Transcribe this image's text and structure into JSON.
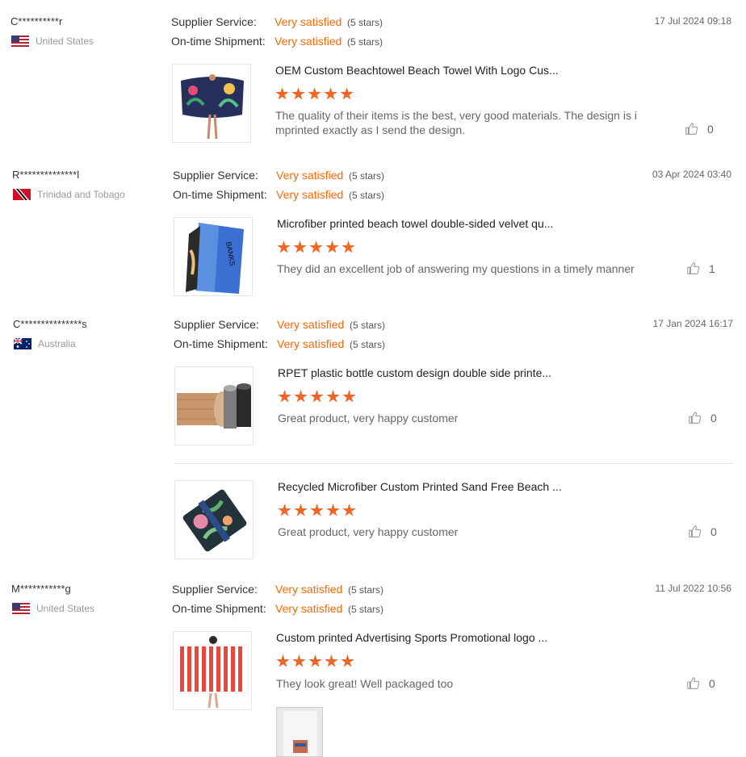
{
  "labels": {
    "supplier_service": "Supplier Service:",
    "ontime_shipment": "On-time Shipment:",
    "very_satisfied": "Very satisfied",
    "five_stars": "(5 stars)"
  },
  "colors": {
    "accent": "#ff6600",
    "star": "#f16522"
  },
  "reviews": [
    {
      "name": "C**********r",
      "country": "United States",
      "date": "17 Jul 2024 09:18",
      "items": [
        {
          "title": "OEM Custom Beachtowel Beach Towel With Logo Cus...",
          "rating": 5,
          "text_line1": "The quality of their items is the best, very good materials. The design is i",
          "text_line2": "mprinted exactly as I send the design.",
          "likes": "0"
        }
      ]
    },
    {
      "name": "R**************l",
      "country": "Trinidad and Tobago",
      "date": "03 Apr 2024 03:40",
      "items": [
        {
          "title": "Microfiber printed beach towel double-sided velvet qu...",
          "rating": 5,
          "text_line1": "They did an excellent job of answering my questions in a timely manner",
          "likes": "1"
        }
      ]
    },
    {
      "name": "C***************s",
      "country": "Australia",
      "date": "17 Jan 2024 16:17",
      "items": [
        {
          "title": "RPET plastic bottle custom design double side printe...",
          "rating": 5,
          "text_line1": "Great product, very happy customer",
          "likes": "0"
        },
        {
          "title": "Recycled Microfiber Custom Printed Sand Free Beach ...",
          "rating": 5,
          "text_line1": "Great product, very happy customer",
          "likes": "0"
        }
      ]
    },
    {
      "name": "M***********g",
      "country": "United States",
      "date": "11 Jul 2022 10:56",
      "items": [
        {
          "title": "Custom printed Advertising Sports Promotional logo ...",
          "rating": 5,
          "text_line1": "They look great! Well packaged too",
          "likes": "0"
        }
      ]
    }
  ]
}
